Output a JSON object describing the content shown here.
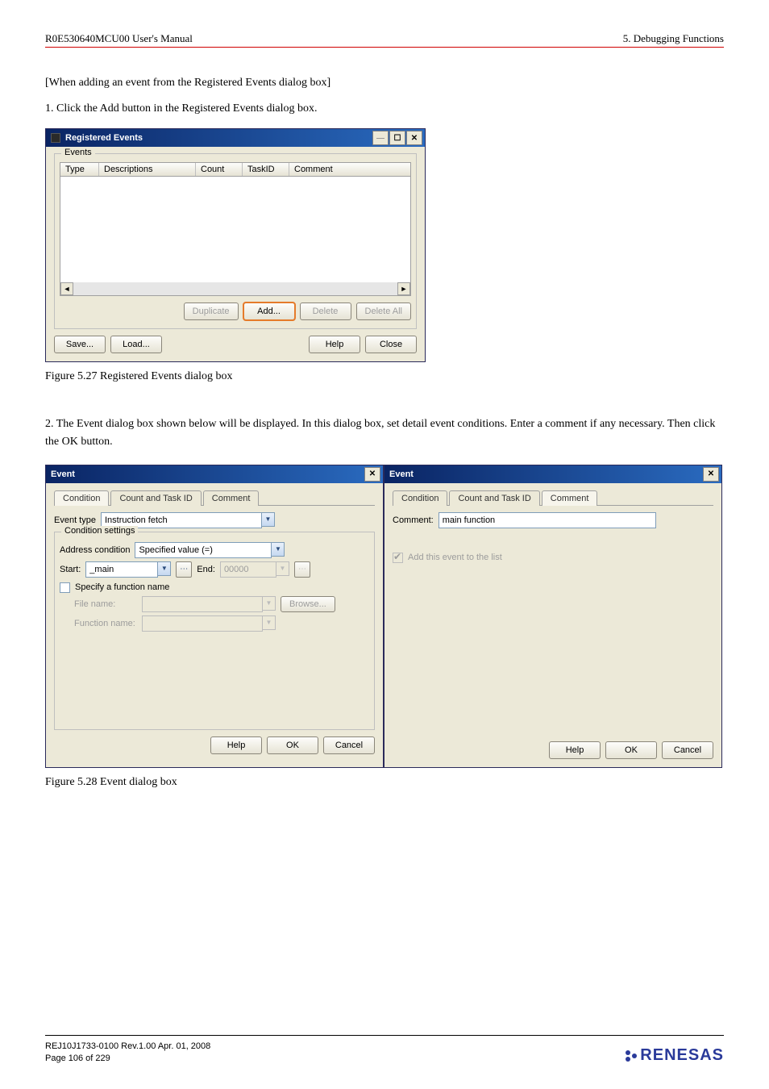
{
  "header": {
    "left": "R0E530640MCU00 User's Manual",
    "right": "5. Debugging Functions"
  },
  "para1": "[When adding an event from the Registered Events dialog box]",
  "para2": "1. Click the Add button in the Registered Events dialog box.",
  "fig1": {
    "title": "Registered Events",
    "group": "Events",
    "cols": {
      "type": "Type",
      "desc": "Descriptions",
      "count": "Count",
      "taskid": "TaskID",
      "comment": "Comment"
    },
    "buttons": {
      "duplicate": "Duplicate",
      "add": "Add...",
      "delete": "Delete",
      "deleteAll": "Delete All",
      "save": "Save...",
      "load": "Load...",
      "help": "Help",
      "close": "Close"
    },
    "caption": "Figure 5.27 Registered Events dialog box"
  },
  "para3": "2. The Event dialog box shown below will be displayed. In this dialog box, set detail event conditions. Enter a comment if any necessary. Then click the OK button.",
  "fig2": {
    "left": {
      "title": "Event",
      "tabs": {
        "condition": "Condition",
        "countTask": "Count and Task ID",
        "comment": "Comment"
      },
      "eventTypeLabel": "Event type",
      "eventTypeValue": "Instruction fetch",
      "condSettings": "Condition settings",
      "addrCondLabel": "Address condition",
      "addrCondValue": "Specified value (=)",
      "startLabel": "Start:",
      "startValue": "_main",
      "endLabel": "End:",
      "endValue": "00000",
      "specifyFn": "Specify a function name",
      "fileLabel": "File name:",
      "browse": "Browse...",
      "fnLabel": "Function name:",
      "help": "Help",
      "ok": "OK",
      "cancel": "Cancel"
    },
    "right": {
      "title": "Event",
      "tabs": {
        "condition": "Condition",
        "countTask": "Count and Task ID",
        "comment": "Comment"
      },
      "commentLabel": "Comment:",
      "commentValue": "main function",
      "addList": "Add this event to the list",
      "help": "Help",
      "ok": "OK",
      "cancel": "Cancel"
    },
    "caption": "Figure 5.28 Event dialog box"
  },
  "footer": {
    "line1": "REJ10J1733-0100   Rev.1.00   Apr. 01, 2008",
    "line2": "Page 106 of 229",
    "logo": "RENESAS"
  }
}
